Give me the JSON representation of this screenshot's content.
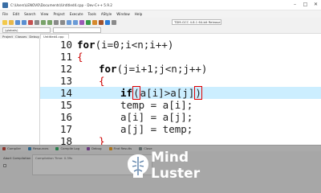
{
  "window": {
    "title": "C:\\Users\\LENOVO\\Documents\\Untitled4.cpp - Dev-C++ 5.9.2",
    "controls": [
      "–",
      "□",
      "✕"
    ]
  },
  "menu": [
    "File",
    "Edit",
    "Search",
    "View",
    "Project",
    "Execute",
    "Tools",
    "AStyle",
    "Window",
    "Help"
  ],
  "toolbar": {
    "compiler": "TDM-GCC 4.8.1 64-bit Release",
    "scope": "(globals)"
  },
  "left_tabs": [
    "Project",
    "Classes",
    "Debug"
  ],
  "editor_tab": "Untitled4.cpp",
  "code": [
    {
      "num": "10",
      "tokens": [
        {
          "t": "for",
          "c": "kw"
        },
        {
          "t": "(i=0;i<n;i++)",
          "c": ""
        }
      ]
    },
    {
      "num": "11",
      "tokens": [
        {
          "t": "{",
          "c": "sym"
        }
      ]
    },
    {
      "num": "12",
      "tokens": [
        {
          "t": "for",
          "c": "kw"
        },
        {
          "t": "(j=i+1;j<n;j++)",
          "c": ""
        }
      ]
    },
    {
      "num": "13",
      "tokens": [
        {
          "t": "{",
          "c": "sym"
        }
      ]
    },
    {
      "num": "14",
      "tokens": [
        {
          "t": "if",
          "c": "kw"
        },
        {
          "t": "(",
          "c": "hl"
        },
        {
          "t": "a[i]>a[j]",
          "c": ""
        },
        {
          "t": ")",
          "c": "hl"
        }
      ]
    },
    {
      "num": "15",
      "tokens": [
        {
          "t": "temp = a[i];",
          "c": ""
        }
      ]
    },
    {
      "num": "16",
      "tokens": [
        {
          "t": "a[i] = a[j];",
          "c": ""
        }
      ]
    },
    {
      "num": "17",
      "tokens": [
        {
          "t": "a[j] = temp;",
          "c": ""
        }
      ]
    },
    {
      "num": "18",
      "tokens": [
        {
          "t": "}",
          "c": "sym"
        }
      ]
    }
  ],
  "current_line": "14",
  "bottom_tabs": [
    "Compiler",
    "Resources",
    "Compile Log",
    "Debug",
    "Find Results",
    "Close"
  ],
  "bottom_panel": {
    "label": "Abort Compilation",
    "output": "Compilation Time: 0.39s"
  },
  "logo": {
    "line1": "Mind",
    "line2": "Luster"
  },
  "colors": {
    "current_line_bg": "#cceeff",
    "keyword": "#000000",
    "bracket": "#cc0000",
    "paren_match": "#e00000"
  }
}
